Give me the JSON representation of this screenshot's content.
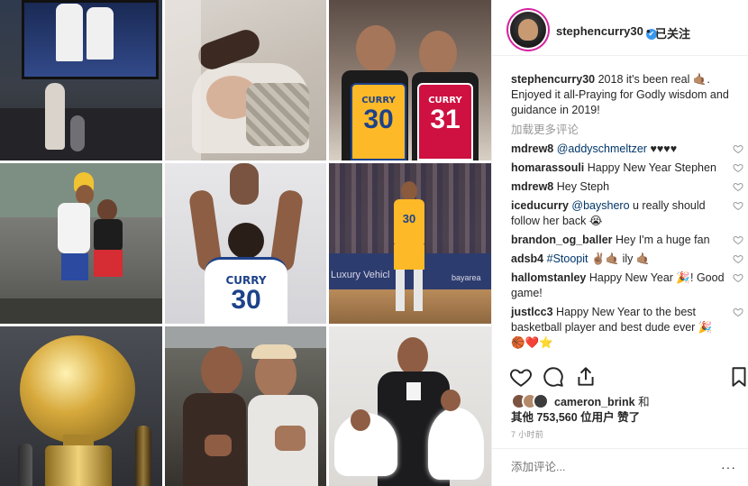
{
  "header": {
    "username": "stephencurry30",
    "verified_glyph": "✔",
    "separator": "•",
    "follow_status": "已关注"
  },
  "caption": {
    "username": "stephencurry30",
    "text": " 2018 it's been real 🤙🏽. Enjoyed it all-Praying for Godly wisdom and guidance in 2019!"
  },
  "load_more": "加载更多评论",
  "comments": [
    {
      "user": "mdrew8",
      "mention": "@addyschmeltzer",
      "text": " ♥♥♥♥"
    },
    {
      "user": "homarassouli",
      "mention": "",
      "text": " Happy New Year Stephen"
    },
    {
      "user": "mdrew8",
      "mention": "",
      "text": " Hey Steph"
    },
    {
      "user": "iceducurry",
      "mention": "@bayshero",
      "text": " u really should follow her back 😭"
    },
    {
      "user": "brandon_og_baller",
      "mention": "",
      "text": " Hey I'm a huge fan"
    },
    {
      "user": "adsb4",
      "mention": "#Stoopit",
      "text": " ✌🏽🤙🏽 ily 🤙🏽"
    },
    {
      "user": "hallomstanley",
      "mention": "",
      "text": " Happy New Year 🎉! Good game!"
    },
    {
      "user": "justlcc3",
      "mention": "",
      "text": " Happy New Year to the best basketball player and best dude ever 🎉🏀❤️⭐"
    }
  ],
  "likes": {
    "first_user": "cameron_brink",
    "joiner": " 和",
    "others_prefix": "其他 ",
    "count": "753,560",
    "suffix": " 位用户 赞了"
  },
  "timestamp": "7 小时前",
  "add_comment_placeholder": "添加评论...",
  "more_glyph": "···",
  "grid_text": {
    "jersey_left_name": "CURRY",
    "jersey_left_number": "30",
    "jersey_right_name": "CURRY",
    "jersey_right_number": "31",
    "jersey_back_name": "CURRY",
    "jersey_back_number": "30",
    "jersey_front_number": "30",
    "court_banner": "Luxury Vehicl",
    "court_banner_right": "bayarea"
  },
  "colors": {
    "accent_blue": "#3897f0",
    "mention": "#003569",
    "muted": "#999999",
    "text": "#262626",
    "warriors_gold": "#fdb927",
    "rockets_red": "#ce1141"
  },
  "icons": [
    "heart-icon",
    "comment-icon",
    "share-icon",
    "bookmark-icon",
    "verified-icon"
  ]
}
